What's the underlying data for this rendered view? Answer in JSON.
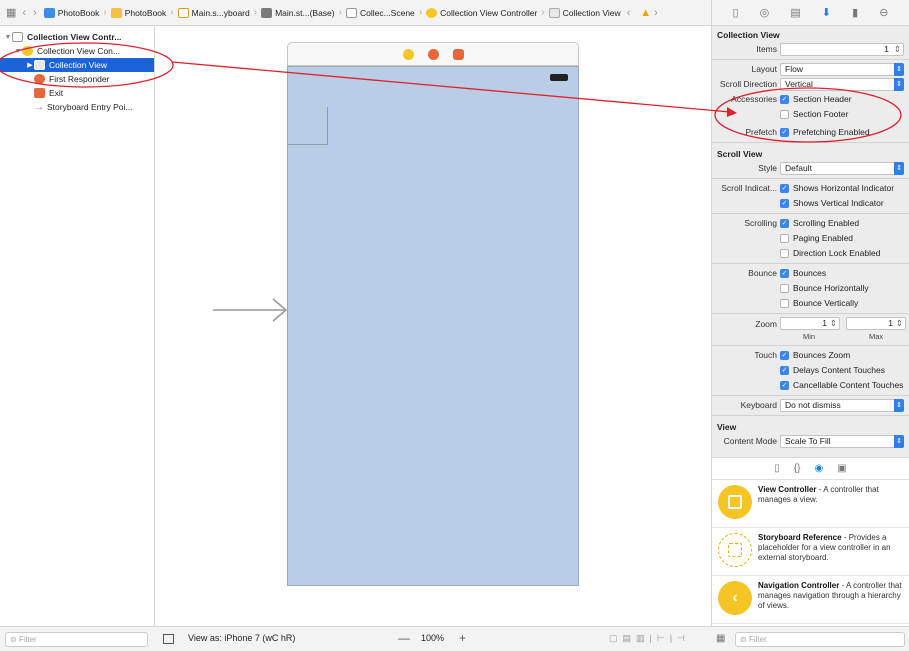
{
  "breadcrumbs": [
    {
      "label": "PhotoBook",
      "icon": "blue"
    },
    {
      "label": "PhotoBook",
      "icon": "folder"
    },
    {
      "label": "Main.s...yboard",
      "icon": "doc"
    },
    {
      "label": "Main.st...(Base)",
      "icon": "sb"
    },
    {
      "label": "Collec...Scene",
      "icon": "scene"
    },
    {
      "label": "Collection View Controller",
      "icon": "vc"
    },
    {
      "label": "Collection View",
      "icon": "cv"
    }
  ],
  "outline": {
    "items": [
      {
        "label": "Collection View Contr...",
        "icon": "scene",
        "disclosure": "▼"
      },
      {
        "label": "Collection View Con...",
        "icon": "vc",
        "disclosure": "▼"
      },
      {
        "label": "Collection View",
        "icon": "cv",
        "disclosure": "▶"
      },
      {
        "label": "First Responder",
        "icon": "fr",
        "disclosure": ""
      },
      {
        "label": "Exit",
        "icon": "exit",
        "disclosure": ""
      },
      {
        "label": "Storyboard Entry Poi...",
        "icon": "arrow",
        "disclosure": ""
      }
    ]
  },
  "inspector": {
    "collection_view": {
      "title": "Collection View",
      "items_label": "Items",
      "items_value": "1",
      "layout_label": "Layout",
      "layout_value": "Flow",
      "scroll_direction_label": "Scroll Direction",
      "scroll_direction_value": "Vertical",
      "accessories_label": "Accessories",
      "section_header": "Section Header",
      "section_footer": "Section Footer",
      "prefetch_label": "Prefetch",
      "prefetching_enabled": "Prefetching Enabled"
    },
    "scroll_view": {
      "title": "Scroll View",
      "style_label": "Style",
      "style_value": "Default",
      "indicators_label": "Scroll Indicat...",
      "shows_horizontal": "Shows Horizontal Indicator",
      "shows_vertical": "Shows Vertical Indicator",
      "scrolling_label": "Scrolling",
      "scrolling_enabled": "Scrolling Enabled",
      "paging_enabled": "Paging Enabled",
      "direction_lock": "Direction Lock Enabled",
      "bounce_label": "Bounce",
      "bounces": "Bounces",
      "bounce_h": "Bounce Horizontally",
      "bounce_v": "Bounce Vertically",
      "zoom_label": "Zoom",
      "zoom_min": "1",
      "zoom_max": "1",
      "min_label": "Min",
      "max_label": "Max",
      "touch_label": "Touch",
      "bounces_zoom": "Bounces Zoom",
      "delays_touches": "Delays Content Touches",
      "cancellable_touches": "Cancellable Content Touches",
      "keyboard_label": "Keyboard",
      "keyboard_value": "Do not dismiss"
    },
    "view": {
      "title": "View",
      "content_mode_label": "Content Mode",
      "content_mode_value": "Scale To Fill"
    }
  },
  "library": {
    "items": [
      {
        "title": "View Controller",
        "desc": " - A controller that manages a view."
      },
      {
        "title": "Storyboard Reference",
        "desc": " - Provides a placeholder for a view controller in an external storyboard."
      },
      {
        "title": "Navigation Controller",
        "desc": " - A controller that manages navigation through a hierarchy of views."
      }
    ]
  },
  "bottom": {
    "filter_placeholder": "Filter",
    "view_as": "View as: iPhone 7 (wC hR)",
    "zoom_minus": "—",
    "zoom_level": "100%",
    "zoom_plus": "+",
    "library_filter_placeholder": "Filter"
  },
  "colors": {
    "accent": "#1b64d8",
    "checkbox": "#3b87e8",
    "scene_bg": "#b9cde6",
    "annotation": "#e0202a"
  }
}
